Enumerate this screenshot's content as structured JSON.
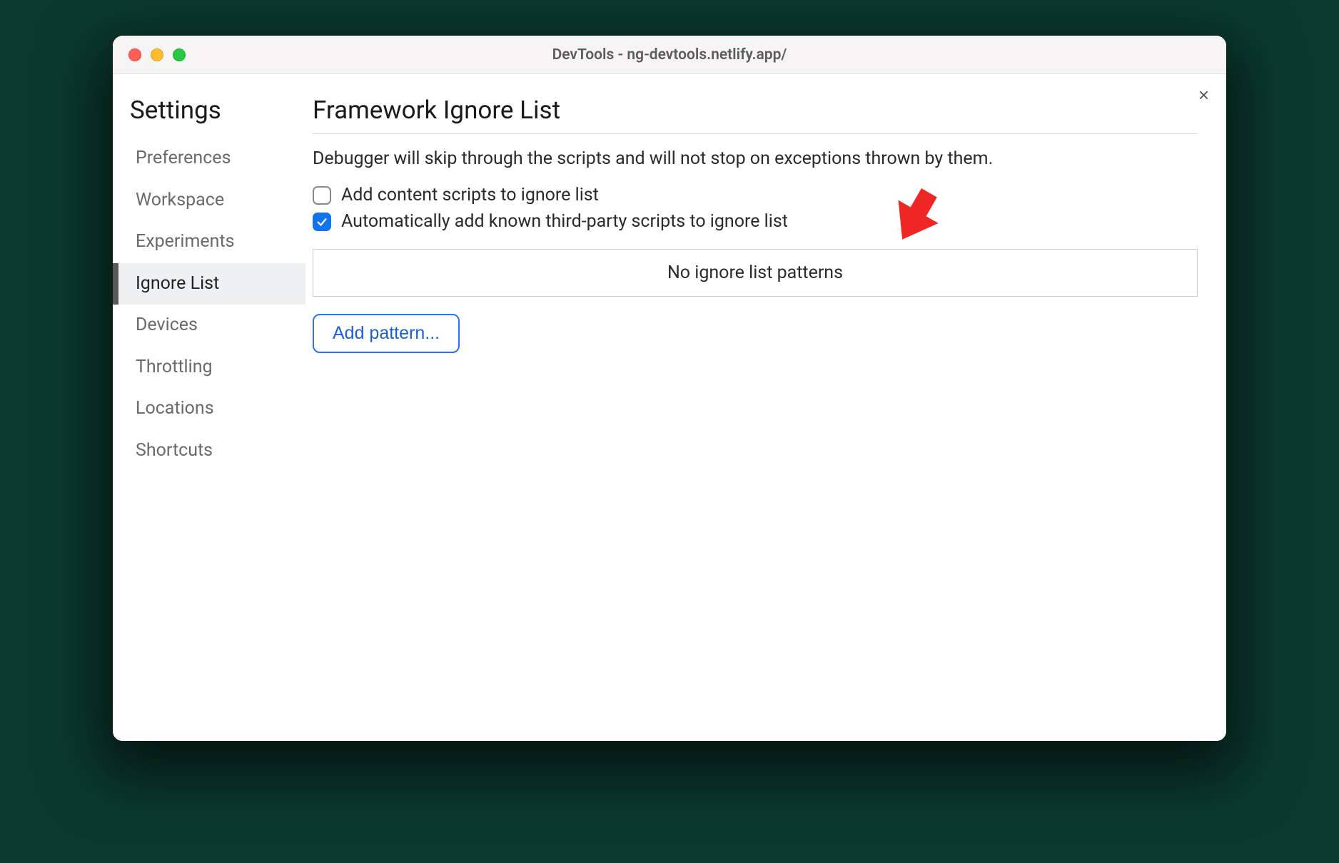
{
  "window": {
    "title": "DevTools - ng-devtools.netlify.app/"
  },
  "close_label": "×",
  "sidebar": {
    "title": "Settings",
    "items": [
      {
        "label": "Preferences",
        "active": false
      },
      {
        "label": "Workspace",
        "active": false
      },
      {
        "label": "Experiments",
        "active": false
      },
      {
        "label": "Ignore List",
        "active": true
      },
      {
        "label": "Devices",
        "active": false
      },
      {
        "label": "Throttling",
        "active": false
      },
      {
        "label": "Locations",
        "active": false
      },
      {
        "label": "Shortcuts",
        "active": false
      }
    ]
  },
  "main": {
    "title": "Framework Ignore List",
    "description": "Debugger will skip through the scripts and will not stop on exceptions thrown by them.",
    "checkboxes": [
      {
        "label": "Add content scripts to ignore list",
        "checked": false
      },
      {
        "label": "Automatically add known third-party scripts to ignore list",
        "checked": true
      }
    ],
    "empty_message": "No ignore list patterns",
    "add_button_label": "Add pattern..."
  }
}
